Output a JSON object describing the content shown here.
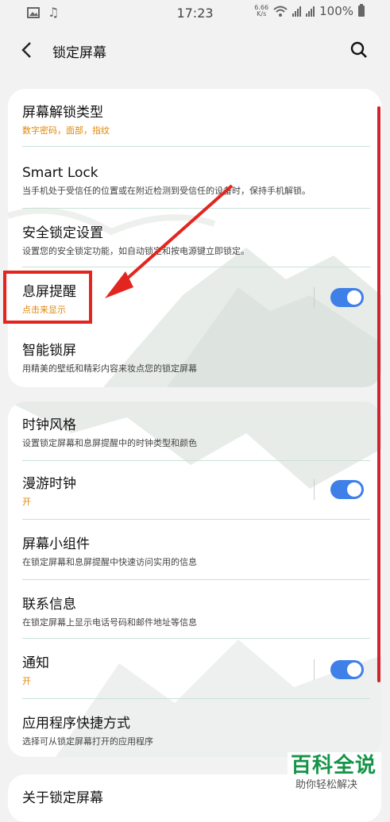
{
  "status_bar": {
    "time": "17:23",
    "net_speed_value": "6.66",
    "net_speed_unit": "K/s",
    "battery": "100%",
    "icons": [
      "image-icon",
      "music-icon",
      "wifi-icon",
      "signal-4g-icon",
      "signal-e-icon",
      "battery-icon"
    ]
  },
  "header": {
    "title": "锁定屏幕",
    "icons": [
      "back-arrow-icon",
      "search-icon"
    ]
  },
  "section1": {
    "items": [
      {
        "title": "屏幕解锁类型",
        "subtitle": "数字密码，面部，指纹"
      },
      {
        "title": "Smart Lock",
        "subtitle": "当手机处于受信任的位置或在附近检测到受信任的设备时，保持手机解锁。"
      },
      {
        "title": "安全锁定设置",
        "subtitle": "设置您的安全锁定功能，如自动锁定和按电源键立即锁定。"
      },
      {
        "title": "息屏提醒",
        "subtitle": "点击来显示",
        "toggle": true
      },
      {
        "title": "智能锁屏",
        "subtitle": "用精美的壁纸和精彩内容来妆点您的锁定屏幕"
      }
    ]
  },
  "section2": {
    "items": [
      {
        "title": "时钟风格",
        "subtitle": "设置锁定屏幕和息屏提醒中的时钟类型和颜色"
      },
      {
        "title": "漫游时钟",
        "subtitle": "开",
        "toggle": true
      },
      {
        "title": "屏幕小组件",
        "subtitle": "在锁定屏幕和息屏提醒中快速访问实用的信息"
      },
      {
        "title": "联系信息",
        "subtitle": "在锁定屏幕上显示电话号码和邮件地址等信息"
      },
      {
        "title": "通知",
        "subtitle": "开",
        "toggle": true
      },
      {
        "title": "应用程序快捷方式",
        "subtitle": "选择可从锁定屏幕打开的应用程序"
      }
    ]
  },
  "section3": {
    "items": [
      {
        "title": "关于锁定屏幕"
      }
    ]
  },
  "watermark": {
    "main": "百科全说",
    "sub": "助你轻松解决"
  },
  "colors": {
    "toggle_on": "#3f80e8",
    "subtitle_orange": "#e0880a",
    "annotation_red": "#e2261f",
    "watermark_green": "#159447"
  }
}
